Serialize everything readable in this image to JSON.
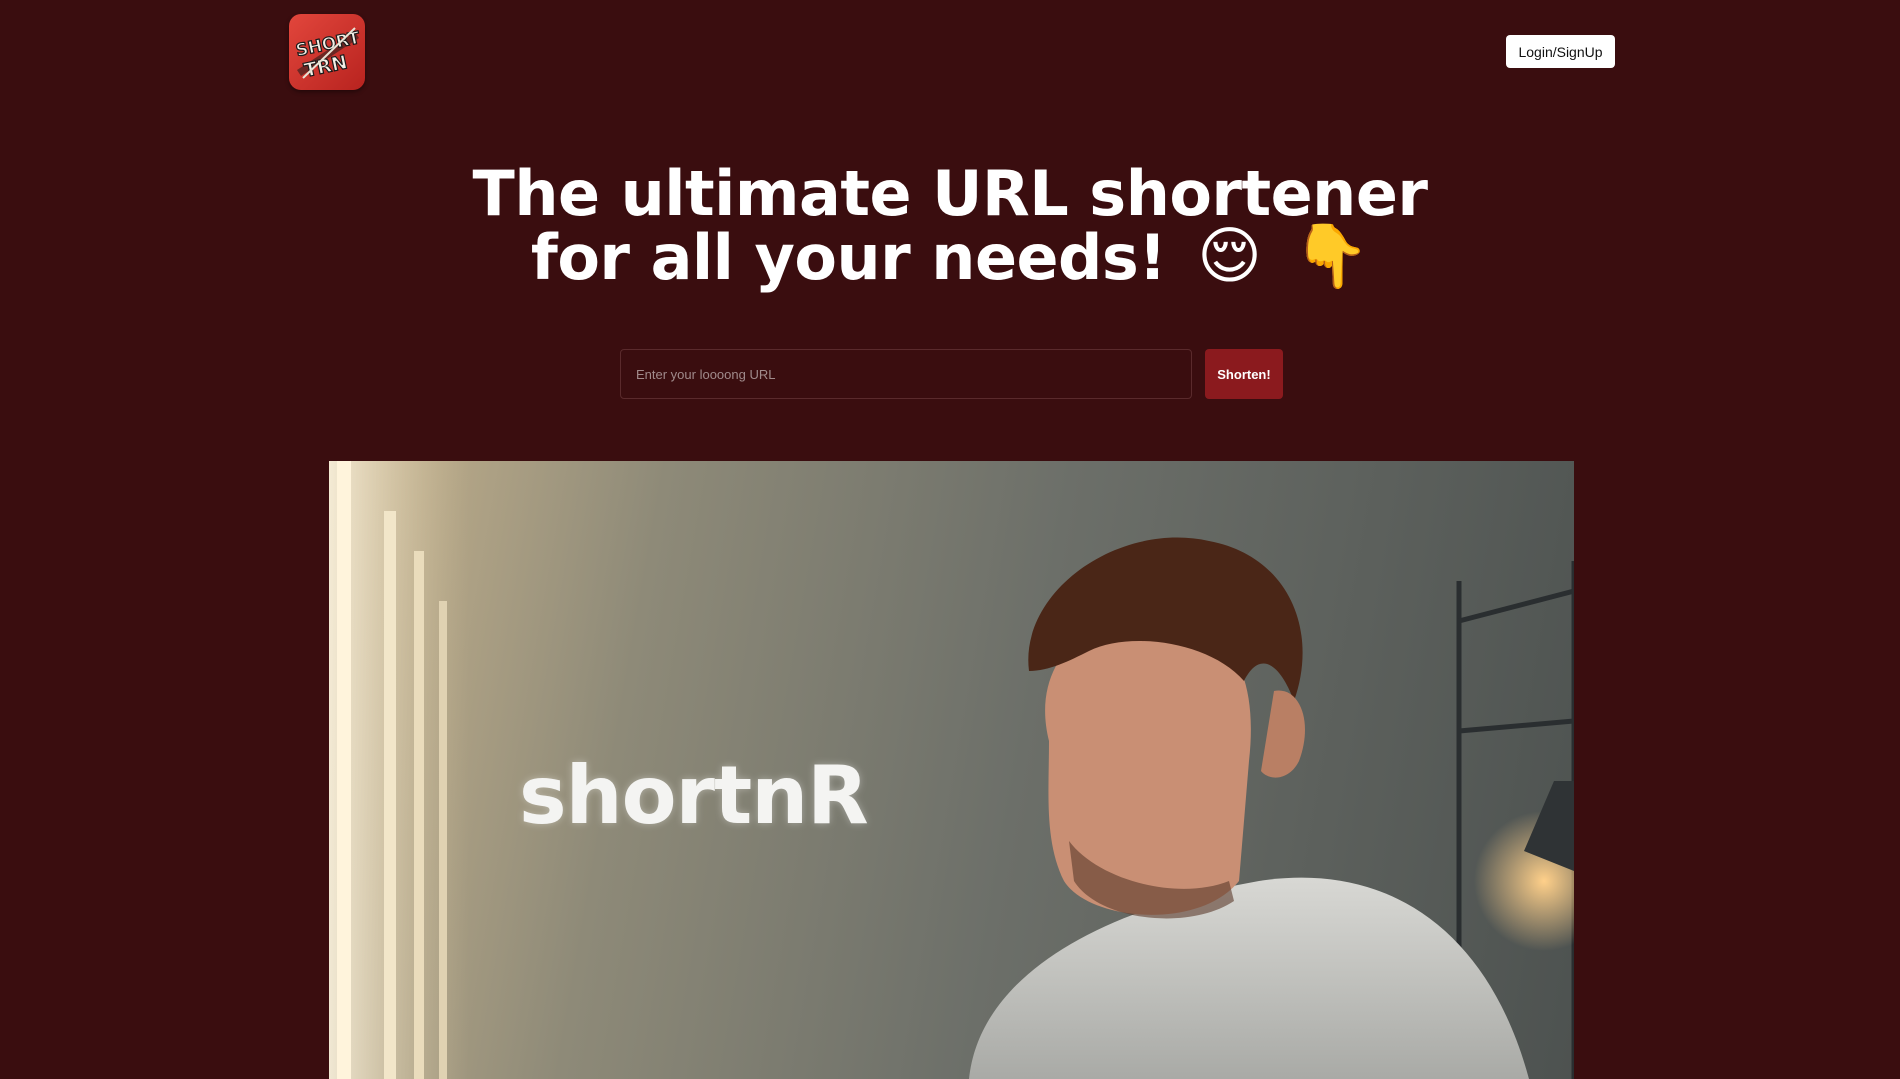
{
  "brand": {
    "logo_text_top": "SHORT",
    "logo_text_bottom": "TRN"
  },
  "header": {
    "login_label": "Login/SignUp"
  },
  "hero": {
    "headline_line1": "The ultimate URL shortener",
    "headline_line2": "for all your needs!",
    "emoji_1": "😌",
    "emoji_2": "👇"
  },
  "form": {
    "url_placeholder": "Enter your loooong URL",
    "url_value": "",
    "submit_label": "Shorten!"
  },
  "image": {
    "overlay_text": "shortnR"
  },
  "colors": {
    "background": "#3a0d0f",
    "accent": "#8b1a1e",
    "button_light": "#ffffff"
  }
}
